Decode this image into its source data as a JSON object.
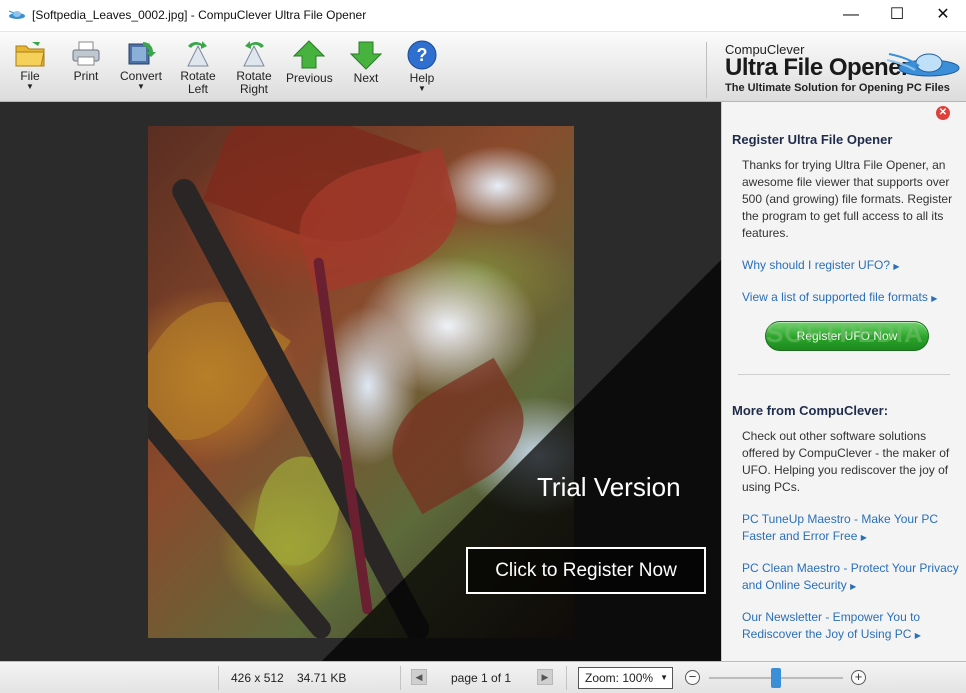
{
  "window": {
    "title": "[Softpedia_Leaves_0002.jpg] - CompuClever Ultra File Opener",
    "app_icon": "ufo-icon",
    "controls": {
      "minimize": "—",
      "maximize": "☐",
      "close": "✕"
    }
  },
  "toolbar": {
    "items": [
      {
        "label": "File",
        "icon": "folder-icon",
        "dropdown": true
      },
      {
        "label": "Print",
        "icon": "printer-icon",
        "dropdown": false
      },
      {
        "label": "Convert",
        "icon": "convert-icon",
        "dropdown": true
      },
      {
        "label": "Rotate\nLeft",
        "icon": "rotate-left-icon",
        "dropdown": false
      },
      {
        "label": "Rotate\nRight",
        "icon": "rotate-right-icon",
        "dropdown": false
      },
      {
        "label": "Previous",
        "icon": "arrow-up-icon",
        "dropdown": false
      },
      {
        "label": "Next",
        "icon": "arrow-down-icon",
        "dropdown": false
      },
      {
        "label": "Help",
        "icon": "help-icon",
        "dropdown": true
      }
    ],
    "arrow": "▼"
  },
  "brand": {
    "company": "CompuClever",
    "product": "Ultra File Opener",
    "tagline": "The Ultimate Solution for Opening PC Files"
  },
  "viewer": {
    "image_name": "Softpedia_Leaves_0002.jpg",
    "overlay_text": "Trial Version",
    "register_button": "Click to Register Now"
  },
  "side_panel": {
    "close_icon": "✕",
    "register_heading": "Register Ultra File Opener",
    "register_text": "Thanks for trying Ultra File Opener, an awesome file viewer that supports over 500 (and growing) file formats. Register the program to get full access to all its features.",
    "link_why": "Why should I register UFO?",
    "link_formats": "View a list of supported file formats",
    "register_ufo_button": "Register UFO Now",
    "watermark": "SOFTPEDIA",
    "more_heading": "More from CompuClever:",
    "more_text": "Check out other software solutions offered by CompuClever - the maker of UFO. Helping you rediscover the joy of using PCs.",
    "link_tuneup": "PC TuneUp Maestro - Make Your PC Faster and Error Free",
    "link_clean": "PC Clean Maestro - Protect Your Privacy and Online Security",
    "link_newsletter": "Our Newsletter - Empower You to Rediscover the Joy of Using PC",
    "chevron": "▶"
  },
  "status_bar": {
    "dimensions": "426 x 512",
    "file_size": "34.71 KB",
    "prev_page": "◀",
    "page_label": "page 1 of 1",
    "next_page": "▶",
    "zoom_label": "Zoom: 100%",
    "zoom_dropdown": "▼",
    "zoom_out": "−",
    "zoom_in": "+",
    "zoom_level": 0.5
  },
  "colors": {
    "accent_link": "#2a6fb8",
    "heading": "#1f2b4a",
    "register_green": "#2aa32a",
    "close_red": "#e0403a",
    "slider_thumb": "#3b8fd8",
    "viewer_bg": "#2b2b2b"
  }
}
